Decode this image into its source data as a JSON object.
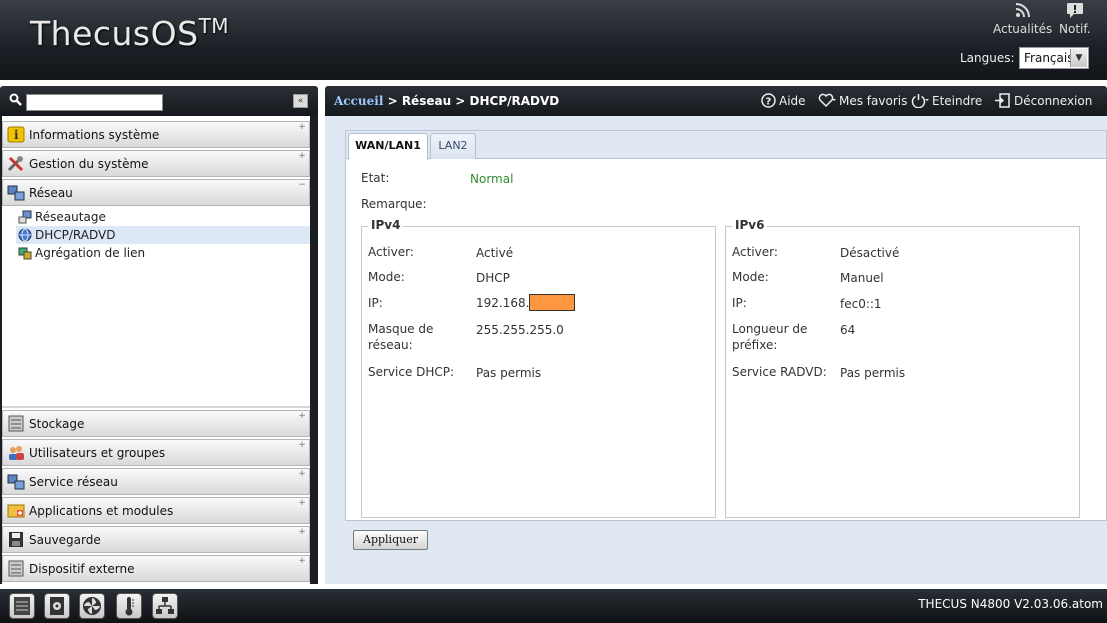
{
  "header": {
    "logo_text": "ThecusOS",
    "logo_tm": "TM",
    "news_label": "Actualités",
    "notif_label": "Notif.",
    "language_label": "Langues:",
    "language_value": "Français"
  },
  "sidebar": {
    "search_placeholder": "",
    "categories": [
      {
        "label": "Informations système",
        "icon": "info-icon"
      },
      {
        "label": "Gestion du système",
        "icon": "tools-icon"
      },
      {
        "label": "Réseau",
        "icon": "network-icon"
      },
      {
        "label": "Stockage",
        "icon": "storage-icon"
      },
      {
        "label": "Utilisateurs et groupes",
        "icon": "users-icon"
      },
      {
        "label": "Service réseau",
        "icon": "network-service-icon"
      },
      {
        "label": "Applications et modules",
        "icon": "applications-icon"
      },
      {
        "label": "Sauvegarde",
        "icon": "backup-icon"
      },
      {
        "label": "Dispositif externe",
        "icon": "external-device-icon"
      }
    ],
    "network_items": [
      {
        "label": "Réseautage",
        "icon": "networking-icon"
      },
      {
        "label": "DHCP/RADVD",
        "icon": "globe-icon"
      },
      {
        "label": "Agrégation de lien",
        "icon": "link-aggregation-icon"
      }
    ]
  },
  "toolbar": {
    "breadcrumb_home": "Accueil",
    "breadcrumb_rest": " > Réseau > DHCP/RADVD",
    "help": "Aide",
    "favorites": "Mes favoris",
    "shutdown": "Eteindre",
    "logout": "Déconnexion"
  },
  "tabs": [
    "WAN/LAN1",
    "LAN2"
  ],
  "status": {
    "state_label": "Etat:",
    "state_value": "Normal",
    "remark_label": "Remarque:"
  },
  "ipv4": {
    "title": "IPv4",
    "enable_label": "Activer:",
    "enable_value": "Activé",
    "mode_label": "Mode:",
    "mode_value": "DHCP",
    "ip_label": "IP:",
    "ip_value": "192.168.",
    "mask_label_1": "Masque de",
    "mask_label_2": "réseau:",
    "mask_value": "255.255.255.0",
    "dhcp_label": "Service DHCP:",
    "dhcp_value": "Pas permis"
  },
  "ipv6": {
    "title": "IPv6",
    "enable_label": "Activer:",
    "enable_value": "Désactivé",
    "mode_label": "Mode:",
    "mode_value": "Manuel",
    "ip_label": "IP:",
    "ip_value": "fec0::1",
    "prefix_label_1": "Longueur de",
    "prefix_label_2": "préfixe:",
    "prefix_value": "64",
    "radvd_label": "Service RADVD:",
    "radvd_value": "Pas permis"
  },
  "apply_label": "Appliquer",
  "footer": {
    "version": "THECUS N4800 V2.03.06.atom"
  },
  "colors": {
    "status_normal": "#2e8b2e",
    "mask_highlight": "#ff9640"
  }
}
